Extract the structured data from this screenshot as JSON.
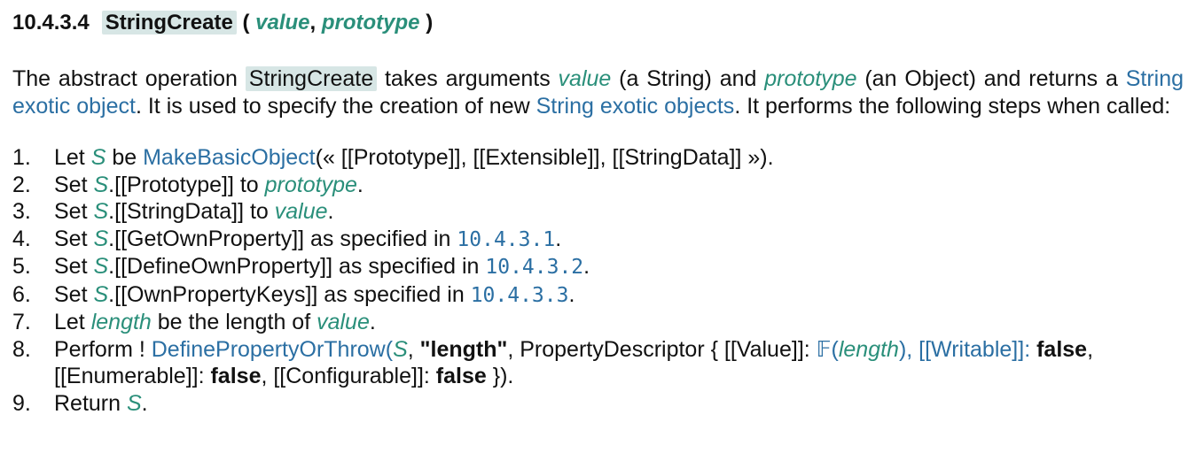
{
  "heading": {
    "number": "10.4.3.4",
    "name": "StringCreate",
    "open": "(",
    "param1": "value",
    "comma": ",",
    "param2": "prototype",
    "close": ")"
  },
  "intro": {
    "t1": "The abstract operation ",
    "op": "StringCreate",
    "t2": " takes arguments ",
    "value": "value",
    "t3": " (a String) and ",
    "prototype": "prototype",
    "t4": " (an Object) and returns a ",
    "link1": "String exotic object",
    "t5": ". It is used to specify the creation of new ",
    "link2": "String exotic objects",
    "t6": ". It performs the following steps when called:"
  },
  "steps": {
    "s1": {
      "num": "1.",
      "a": "Let ",
      "v": "S",
      "b": " be ",
      "link": "MakeBasicObject",
      "c": "(« [[Prototype]], [[Extensible]], [[StringData]] »)."
    },
    "s2": {
      "num": "2.",
      "a": "Set ",
      "v": "S",
      "b": ".[[Prototype]] to ",
      "v2": "prototype",
      "c": "."
    },
    "s3": {
      "num": "3.",
      "a": "Set ",
      "v": "S",
      "b": ".[[StringData]] to ",
      "v2": "value",
      "c": "."
    },
    "s4": {
      "num": "4.",
      "a": "Set ",
      "v": "S",
      "b": ".[[GetOwnProperty]] as specified in ",
      "ref": "10.4.3.1",
      "c": "."
    },
    "s5": {
      "num": "5.",
      "a": "Set ",
      "v": "S",
      "b": ".[[DefineOwnProperty]] as specified in ",
      "ref": "10.4.3.2",
      "c": "."
    },
    "s6": {
      "num": "6.",
      "a": "Set ",
      "v": "S",
      "b": ".[[OwnPropertyKeys]] as specified in ",
      "ref": "10.4.3.3",
      "c": "."
    },
    "s7": {
      "num": "7.",
      "a": "Let ",
      "v": "length",
      "b": " be the length of ",
      "v2": "value",
      "c": "."
    },
    "s8": {
      "num": "8.",
      "a": "Perform ! ",
      "link": "DefinePropertyOrThrow",
      "b": "(",
      "v": "S",
      "c": ", ",
      "str": "\"length\"",
      "d": ", PropertyDescriptor { [[Value]]: ",
      "f": "𝔽",
      "e": "(",
      "v2": "length",
      "g": "), [[Writable]]: ",
      "false1": "false",
      "h": ", [[Enumerable]]: ",
      "false2": "false",
      "i": ", [[Configurable]]: ",
      "false3": "false",
      "j": " })."
    },
    "s9": {
      "num": "9.",
      "a": "Return ",
      "v": "S",
      "c": "."
    }
  }
}
